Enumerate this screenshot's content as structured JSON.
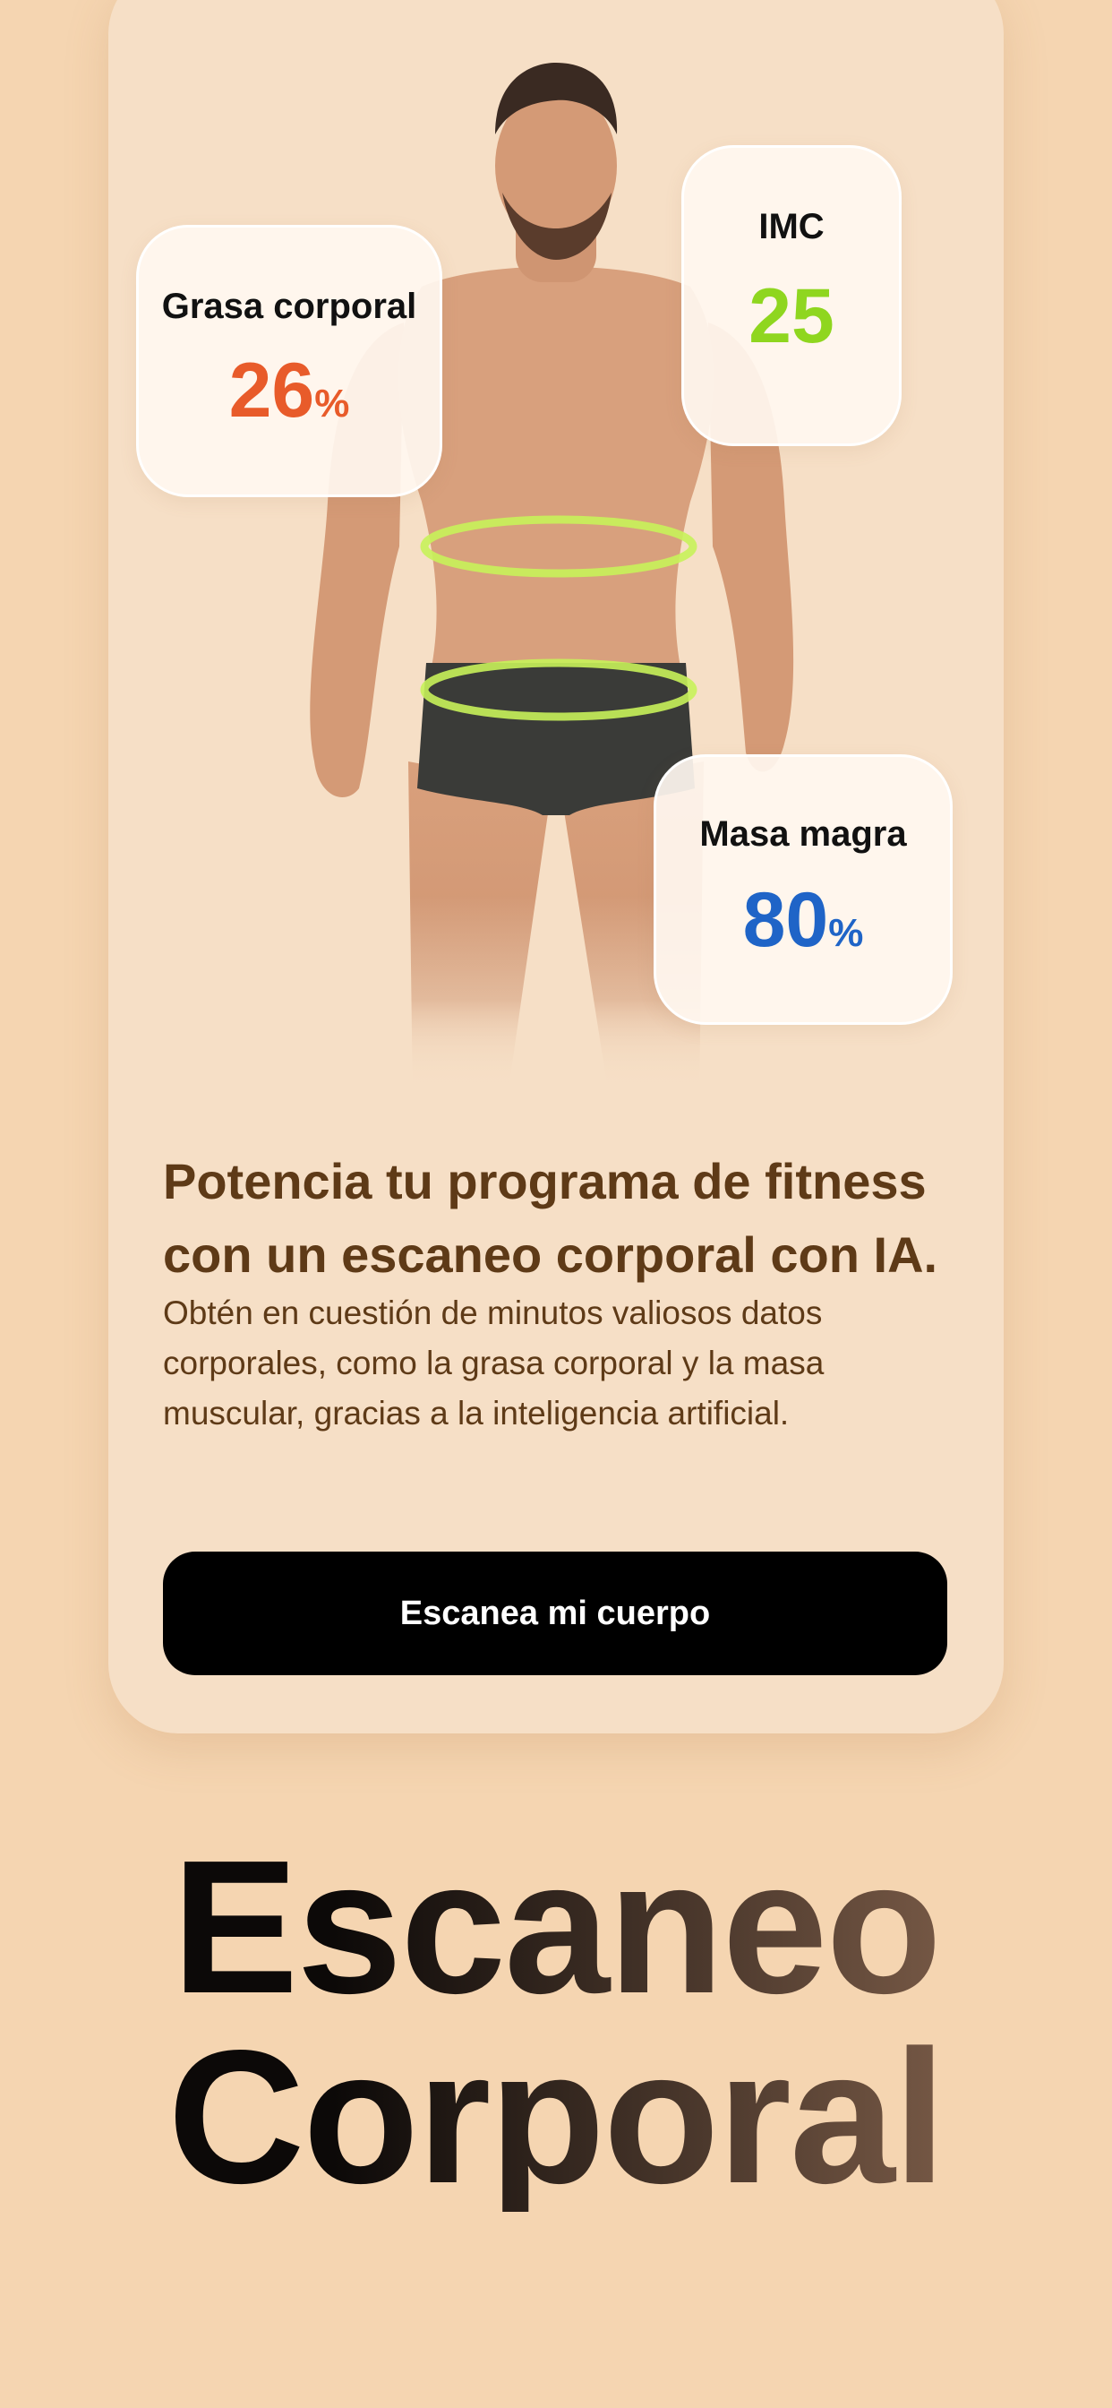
{
  "card": {
    "stats": {
      "body_fat": {
        "label": "Grasa corporal",
        "value": "26",
        "unit": "%"
      },
      "imc": {
        "label": "IMC",
        "value": "25"
      },
      "lean_mass": {
        "label": "Masa magra",
        "value": "80",
        "unit": "%"
      }
    },
    "headline": "Potencia tu programa de fitness con un escaneo corporal con IA.",
    "description": "Obtén en cuestión de minutos valiosos datos corporales, como la grasa corporal y la masa muscular, gracias a la inteligencia artificial.",
    "cta_label": "Escanea mi cuerpo"
  },
  "title": {
    "line1": "Escaneo",
    "line2": "Corporal"
  },
  "colors": {
    "background": "#f5d5b1",
    "card": "#f6dfc6",
    "body_fat": "#e85b2a",
    "imc": "#8fd61f",
    "lean_mass": "#1f64c7",
    "text_brown": "#5e3a17",
    "scan_ring": "#c8f25a"
  }
}
